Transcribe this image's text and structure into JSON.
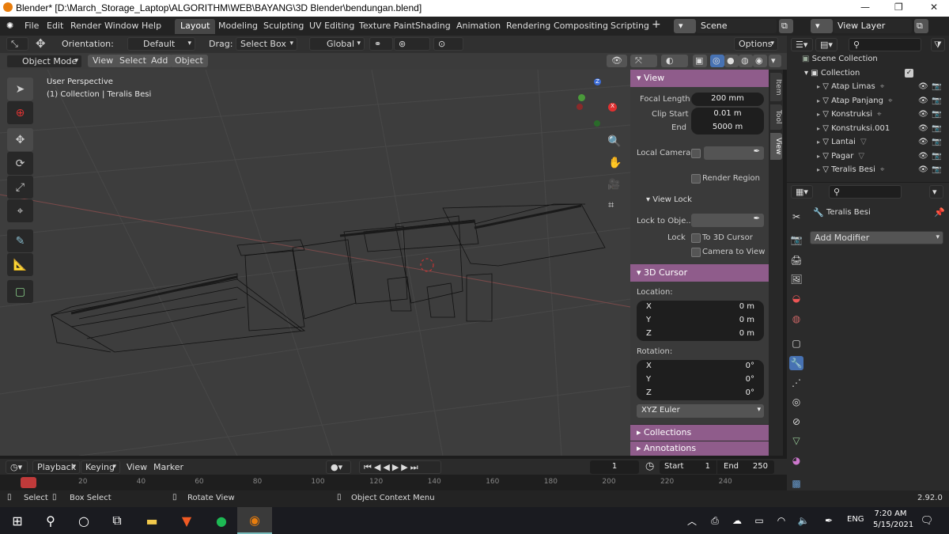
{
  "titlebar": {
    "title": "Blender* [D:\\March_Storage_Laptop\\ALGORITHM\\WEB\\BAYANG\\3D Blender\\bendungan.blend]"
  },
  "menus": {
    "file": "File",
    "edit": "Edit",
    "render": "Render",
    "window": "Window",
    "help": "Help"
  },
  "workspaces": [
    "Layout",
    "Modeling",
    "Sculpting",
    "UV Editing",
    "Texture Paint",
    "Shading",
    "Animation",
    "Rendering",
    "Compositing",
    "Scripting"
  ],
  "scene": {
    "name": "Scene",
    "view_layer": "View Layer"
  },
  "toolheader": {
    "orientation_label": "Orientation:",
    "orientation_value": "Default",
    "drag_label": "Drag:",
    "drag_value": "Select Box",
    "transform": "Global",
    "options": "Options"
  },
  "viewport_header": {
    "mode": "Object Mode",
    "view": "View",
    "select": "Select",
    "add": "Add",
    "object": "Object"
  },
  "viewport": {
    "perspective": "User Perspective",
    "collection_info": "(1) Collection | Teralis Besi",
    "gizmo_x": "X",
    "gizmo_y": "Y",
    "gizmo_z": "Z"
  },
  "npanel": {
    "view_header": "View",
    "focal_length_label": "Focal Length",
    "focal_length": "200 mm",
    "clip_start_label": "Clip Start",
    "clip_start": "0.01 m",
    "clip_end_label": "End",
    "clip_end": "5000 m",
    "local_camera_label": "Local Camera",
    "render_region": "Render Region",
    "view_lock": "View Lock",
    "lock_to_object_label": "Lock to Obje...",
    "lock_label": "Lock",
    "to_3d_cursor": "To 3D Cursor",
    "camera_to_view": "Camera to View",
    "cursor_header": "3D Cursor",
    "location_label": "Location:",
    "loc": [
      {
        "axis": "X",
        "value": "0 m"
      },
      {
        "axis": "Y",
        "value": "0 m"
      },
      {
        "axis": "Z",
        "value": "0 m"
      }
    ],
    "rotation_label": "Rotation:",
    "rot": [
      {
        "axis": "X",
        "value": "0°"
      },
      {
        "axis": "Y",
        "value": "0°"
      },
      {
        "axis": "Z",
        "value": "0°"
      }
    ],
    "rotation_mode": "XYZ Euler",
    "collections": "Collections",
    "annotations": "Annotations",
    "tabs": [
      "Item",
      "Tool",
      "View"
    ]
  },
  "timeline": {
    "playback": "Playback",
    "keying": "Keying",
    "view": "View",
    "marker": "Marker",
    "current_frame": "1",
    "start_label": "Start",
    "start": "1",
    "end_label": "End",
    "end": "250",
    "ticks": [
      "20",
      "40",
      "60",
      "80",
      "100",
      "120",
      "140",
      "160",
      "180",
      "200",
      "220",
      "240"
    ]
  },
  "statusbar": {
    "select": "Select",
    "box_select": "Box Select",
    "rotate_view": "Rotate View",
    "context_menu": "Object Context Menu",
    "version": "2.92.0"
  },
  "outliner": {
    "scene_collection": "Scene Collection",
    "collection": "Collection",
    "items": [
      "Atap Limas",
      "Atap Panjang",
      "Konstruksi",
      "Konstruksi.001",
      "Lantai",
      "Pagar",
      "Teralis Besi"
    ]
  },
  "properties": {
    "object_name": "Teralis Besi",
    "add_modifier": "Add Modifier"
  },
  "taskbar": {
    "lang": "ENG",
    "time": "7:20 AM",
    "date": "5/15/2021"
  },
  "colors": {
    "accent_purple": "#8f5c8b",
    "active_blue": "#4772b3",
    "viewport_bg": "#3d3d3d"
  }
}
